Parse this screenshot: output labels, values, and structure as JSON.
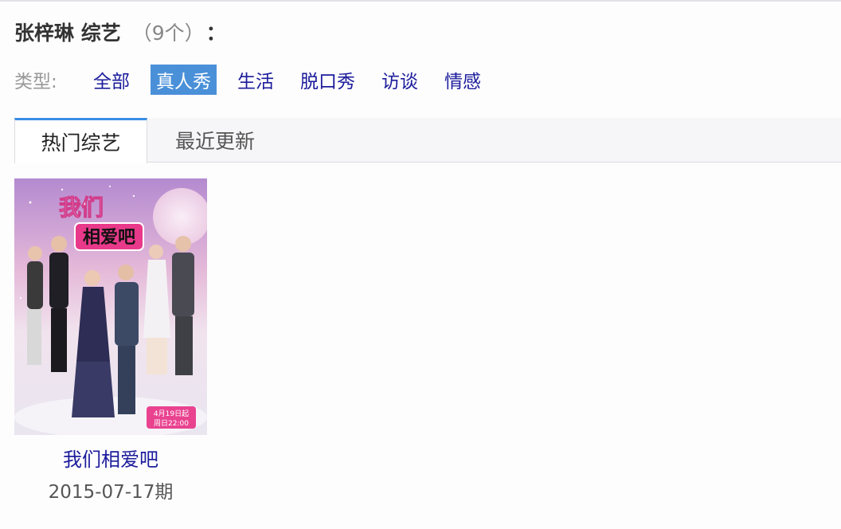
{
  "header": {
    "title": "张梓琳 综艺",
    "count": "（9个）",
    "colon": "："
  },
  "filter": {
    "label": "类型:",
    "items": [
      {
        "label": "全部",
        "active": false
      },
      {
        "label": "真人秀",
        "active": true
      },
      {
        "label": "生活",
        "active": false
      },
      {
        "label": "脱口秀",
        "active": false
      },
      {
        "label": "访谈",
        "active": false
      },
      {
        "label": "情感",
        "active": false
      }
    ]
  },
  "tabs": [
    {
      "label": "热门综艺",
      "active": true
    },
    {
      "label": "最近更新",
      "active": false
    }
  ],
  "shows": [
    {
      "name": "我们相爱吧",
      "date": "2015-07-17期",
      "poster": {
        "title_line1": "我们",
        "title_line2": "相爱吧",
        "badge_line1": "4月19日起",
        "badge_line2": "周日22:00"
      }
    }
  ],
  "colors": {
    "link": "#1c1c9c",
    "accent": "#4a90d9",
    "tab_border": "#3a8ee6",
    "poster_pink": "#e8398a"
  }
}
